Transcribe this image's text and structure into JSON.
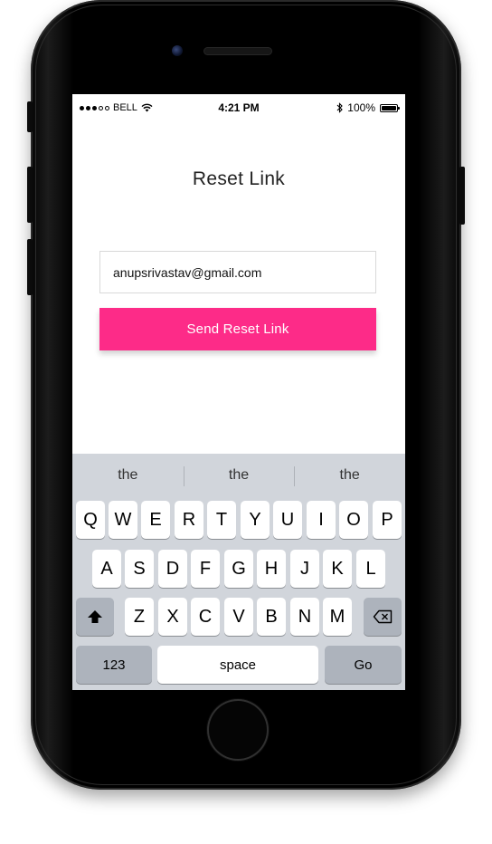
{
  "status_bar": {
    "carrier": "BELL",
    "time": "4:21 PM",
    "battery": "100%",
    "icons": [
      "wifi-icon",
      "bluetooth-icon",
      "battery-icon"
    ]
  },
  "page": {
    "title": "Reset Link"
  },
  "form": {
    "email_value": "anupsrivastav@gmail.com",
    "send_label": "Send Reset Link"
  },
  "keyboard": {
    "suggestions": [
      "the",
      "the",
      "the"
    ],
    "row1": [
      "Q",
      "W",
      "E",
      "R",
      "T",
      "Y",
      "U",
      "I",
      "O",
      "P"
    ],
    "row2": [
      "A",
      "S",
      "D",
      "F",
      "G",
      "H",
      "J",
      "K",
      "L"
    ],
    "row3": [
      "Z",
      "X",
      "C",
      "V",
      "B",
      "N",
      "M"
    ],
    "numbers_label": "123",
    "space_label": "space",
    "go_label": "Go"
  },
  "colors": {
    "accent": "#fd2b88",
    "keyboard_bg": "#d1d5db",
    "dark_key": "#adb3bc"
  }
}
